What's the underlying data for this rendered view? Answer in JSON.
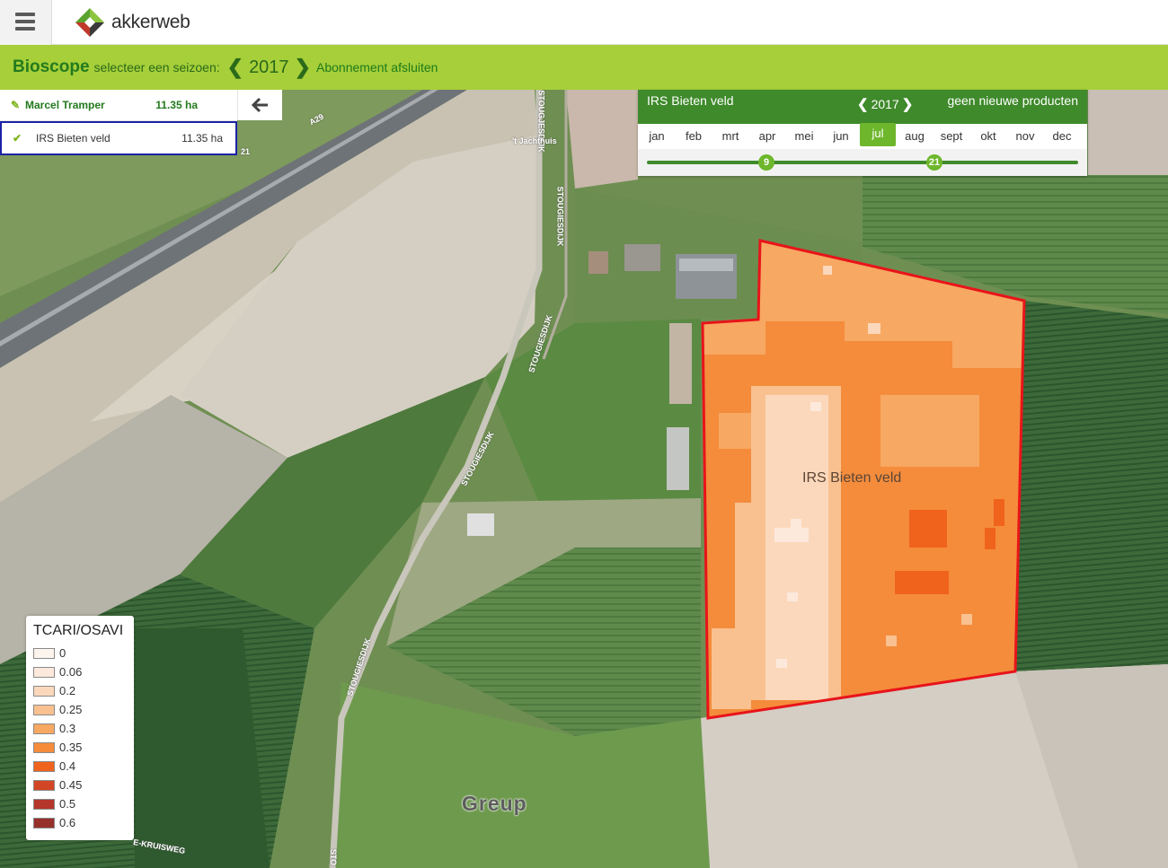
{
  "app": {
    "logo_text": "akkerweb",
    "menu_icon": "hamburger-menu-icon",
    "logo_icon": "akkerweb-logo-icon"
  },
  "season_bar": {
    "brand": "Bioscope",
    "label": "selecteer een seizoen:",
    "year": "2017",
    "subscribe_link": "Abonnement afsluiten",
    "prev_icon": "chevron-left-icon",
    "next_icon": "chevron-right-icon"
  },
  "sidebar": {
    "owner": {
      "name": "Marcel Tramper",
      "area": "11.35 ha",
      "icon": "pencil-icon"
    },
    "field": {
      "name": "IRS Bieten veld",
      "area": "11.35 ha",
      "icon": "checkmark-icon"
    },
    "back_icon": "arrow-left-icon"
  },
  "timeline": {
    "field": "IRS Bieten veld",
    "year": "2017",
    "products": "geen nieuwe producten",
    "months": [
      "jan",
      "feb",
      "mrt",
      "apr",
      "mei",
      "jun",
      "jul",
      "aug",
      "sept",
      "okt",
      "nov",
      "dec"
    ],
    "active_month": "jul",
    "markers": [
      "9",
      "21"
    ]
  },
  "map": {
    "field_label": "IRS Bieten veld",
    "place_label": "Greup",
    "road_labels": [
      "A29",
      "STOUGJESDIJK",
      "STOUGIESDIJK",
      "STOUGIESDIJK",
      "STOUGIESDIJK",
      "STOUGIESDIJK",
      "E-KRUISWEG",
      "STO",
      "'t Jachthuis",
      "21"
    ]
  },
  "legend": {
    "title": "TCARI/OSAVI",
    "items": [
      {
        "label": "0",
        "color": "#fdf4ee"
      },
      {
        "label": "0.06",
        "color": "#fde9dc"
      },
      {
        "label": "0.2",
        "color": "#fbd8bb"
      },
      {
        "label": "0.25",
        "color": "#f9c190"
      },
      {
        "label": "0.3",
        "color": "#f7a862"
      },
      {
        "label": "0.35",
        "color": "#f48c3c"
      },
      {
        "label": "0.4",
        "color": "#f0631d"
      },
      {
        "label": "0.45",
        "color": "#d24626"
      },
      {
        "label": "0.5",
        "color": "#b5362a"
      },
      {
        "label": "0.6",
        "color": "#96302b"
      }
    ]
  },
  "colors": {
    "accent_green": "#a6cf39",
    "dark_green": "#3f8a2b",
    "selection_border": "#1c22a6",
    "field_border": "#e8141a"
  }
}
